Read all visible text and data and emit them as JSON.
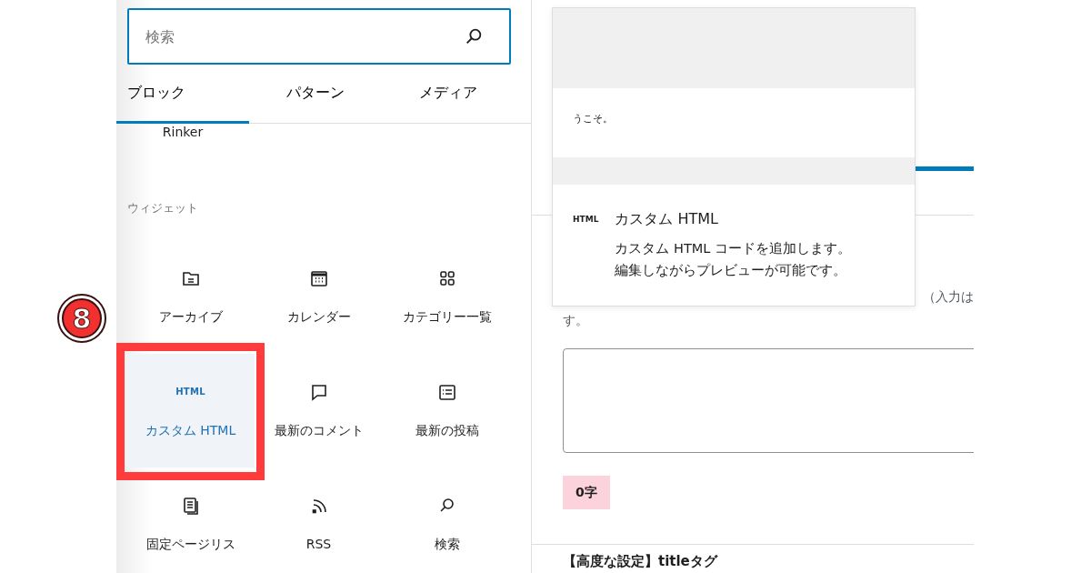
{
  "annotation": {
    "step": "8"
  },
  "search": {
    "placeholder": "検索"
  },
  "tabs": [
    {
      "label": "ブロック",
      "selected": true
    },
    {
      "label": "パターン",
      "selected": false
    },
    {
      "label": "メディア",
      "selected": false
    }
  ],
  "partial_item": {
    "label": "Rinker"
  },
  "widgets": {
    "heading": "ウィジェット",
    "items": [
      {
        "label": "アーカイブ",
        "kind": "archive",
        "selected": false
      },
      {
        "label": "カレンダー",
        "kind": "calendar",
        "selected": false
      },
      {
        "label": "カテゴリー一覧",
        "kind": "categories",
        "selected": false
      },
      {
        "label": "カスタム HTML",
        "kind": "text",
        "icon_text": "HTML",
        "selected": true
      },
      {
        "label": "最新のコメント",
        "kind": "comment",
        "selected": false
      },
      {
        "label": "最新の投稿",
        "kind": "list",
        "selected": false
      },
      {
        "label": "固定ページリス",
        "kind": "pages",
        "selected": false
      },
      {
        "label": "RSS",
        "kind": "rss",
        "selected": false
      },
      {
        "label": "検索",
        "kind": "search",
        "selected": false
      }
    ]
  },
  "popover": {
    "preview_text": "うこそ。",
    "icon_text": "HTML",
    "title": "カスタム HTML",
    "description_lines": [
      "カスタム HTML コードを追加します。",
      "編集しながらプレビューが可能です。"
    ]
  },
  "editor": {
    "note_fragment": "（入力は",
    "note_end": "す。",
    "counter": "0字",
    "section_heading": "【高度な設定】titleタグ"
  }
}
